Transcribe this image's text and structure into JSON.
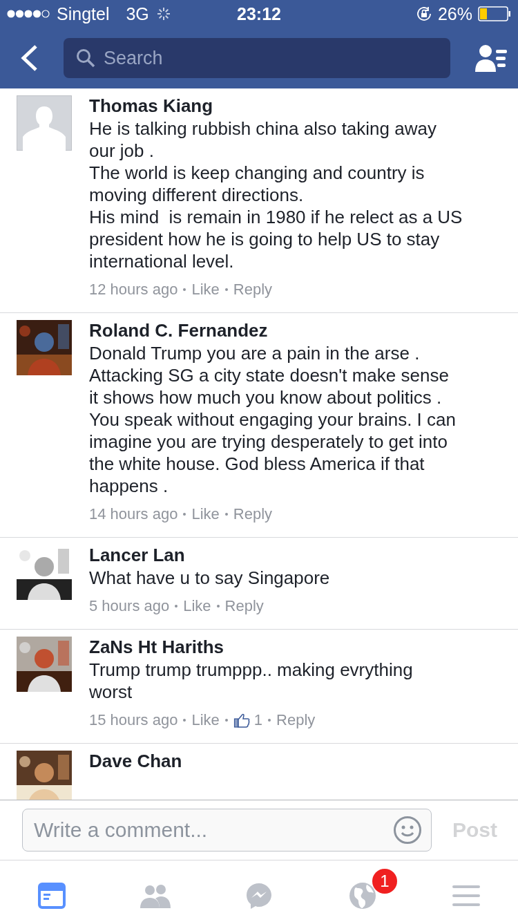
{
  "status_bar": {
    "carrier": "Singtel",
    "network": "3G",
    "time": "23:12",
    "battery": "26%"
  },
  "nav": {
    "search": {
      "placeholder": "Search"
    }
  },
  "comments": [
    {
      "name": "Thomas Kiang",
      "avatar": {
        "kind": "placeholder"
      },
      "text": "He is talking rubbish china also taking away\nour job .\nThe world is keep changing and country is\nmoving different directions.\nHis mind  is remain in 1980 if he relect as a US\npresident how he is going to help US to stay\ninternational level.",
      "time": "12 hours ago",
      "like": "Like",
      "reply": "Reply"
    },
    {
      "name": "Roland C. Fernandez",
      "text": "Donald Trump you are a pain in the arse .\nAttacking SG a city state doesn't make sense\nit shows how much you know about politics .\nYou speak without engaging your brains. I can\nimagine you are trying desperately to get into\nthe white house. God bless America if that\nhappens .",
      "time": "14 hours ago",
      "like": "Like",
      "reply": "Reply"
    },
    {
      "name": "Lancer Lan",
      "text": "What have u to say Singapore",
      "time": "5 hours ago",
      "like": "Like",
      "reply": "Reply"
    },
    {
      "name": "ZaNs Ht Hariths",
      "text": "Trump trump trumppp.. making evrything\nworst",
      "time": "15 hours ago",
      "like": "Like",
      "likes": "1",
      "reply": "Reply"
    },
    {
      "name": "Dave Chan"
    }
  ],
  "composer": {
    "placeholder": "Write a comment...",
    "post": "Post"
  },
  "tab_bar": [
    {
      "kind": "feed",
      "selected": true
    },
    {
      "kind": "friends",
      "selected": false
    },
    {
      "kind": "messenger",
      "selected": false
    },
    {
      "kind": "notifications",
      "selected": false,
      "badge": "1"
    },
    {
      "kind": "menu",
      "selected": false
    }
  ]
}
